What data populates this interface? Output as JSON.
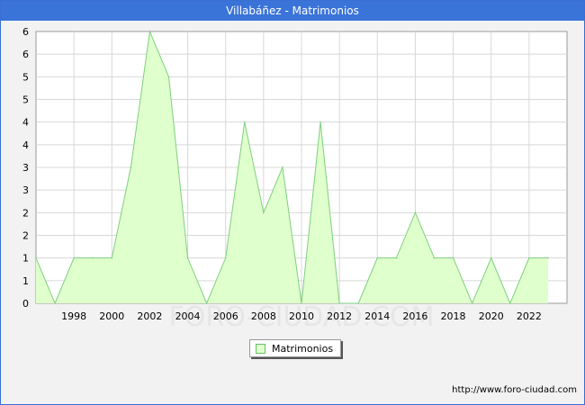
{
  "title": "Villabáñez - Matrimonios",
  "footer_url": "http://www.foro-ciudad.com",
  "watermark": "FORO-CIUDAD.COM",
  "colors": {
    "title_bg": "#3b74d8",
    "area_fill": "#dfffcc",
    "area_stroke": "#7fcf7f",
    "grid": "#d8d8d8"
  },
  "chart_data": {
    "type": "area",
    "title": "Villabáñez - Matrimonios",
    "xlabel": "",
    "ylabel": "",
    "x": [
      1996,
      1997,
      1998,
      1999,
      2000,
      2001,
      2002,
      2003,
      2004,
      2005,
      2006,
      2007,
      2008,
      2009,
      2010,
      2011,
      2012,
      2013,
      2014,
      2015,
      2016,
      2017,
      2018,
      2019,
      2020,
      2021,
      2022,
      2023
    ],
    "series": [
      {
        "name": "Matrimonios",
        "values": [
          1,
          0,
          1,
          1,
          1,
          3,
          6,
          5,
          1,
          0,
          1,
          4,
          2,
          3,
          0,
          4,
          0,
          0,
          1,
          1,
          2,
          1,
          1,
          0,
          1,
          0,
          1,
          1
        ]
      }
    ],
    "xticks": [
      "1998",
      "2000",
      "2002",
      "2004",
      "2006",
      "2008",
      "2010",
      "2012",
      "2014",
      "2016",
      "2018",
      "2020",
      "2022"
    ],
    "ytick_labels": [
      "0",
      "1",
      "1",
      "2",
      "2",
      "3",
      "3",
      "4",
      "4",
      "5",
      "5",
      "6",
      "6"
    ],
    "ylim": [
      0,
      6
    ],
    "xlim": [
      1996,
      2024
    ],
    "grid": true,
    "legend": "bottom-center"
  }
}
